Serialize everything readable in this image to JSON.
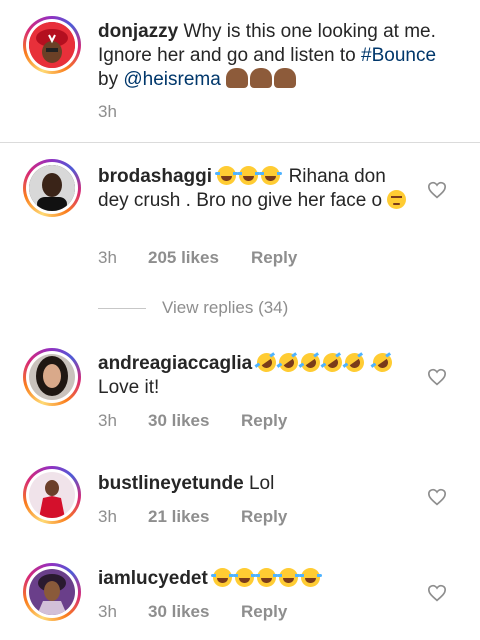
{
  "caption": {
    "username": "donjazzy",
    "text_1": "Why is this one looking at me. Ignore her and go and listen to",
    "hashtag": "#Bounce",
    "text_2": "by",
    "mention": "@heisrema",
    "emoji": [
      "raising-hands-icon",
      "raising-hands-icon",
      "raising-hands-icon"
    ],
    "time": "3h"
  },
  "view_replies_label": "View replies (34)",
  "comments": [
    {
      "username": "brodashaggi",
      "text": "Rihana don dey crush . Bro no give her face o",
      "time": "3h",
      "likes": "205 likes",
      "reply": "Reply"
    },
    {
      "username": "andreagiaccaglia",
      "text": "Love it!",
      "time": "3h",
      "likes": "30 likes",
      "reply": "Reply"
    },
    {
      "username": "bustlineyetunde",
      "text": "Lol",
      "time": "3h",
      "likes": "21 likes",
      "reply": "Reply"
    },
    {
      "username": "iamlucyedet",
      "text": "",
      "time": "3h",
      "likes": "30 likes",
      "reply": "Reply"
    }
  ],
  "colors": {
    "text": "#262626",
    "meta": "#8e8e8e",
    "link": "#00376b",
    "divider": "#dbdbdb"
  }
}
